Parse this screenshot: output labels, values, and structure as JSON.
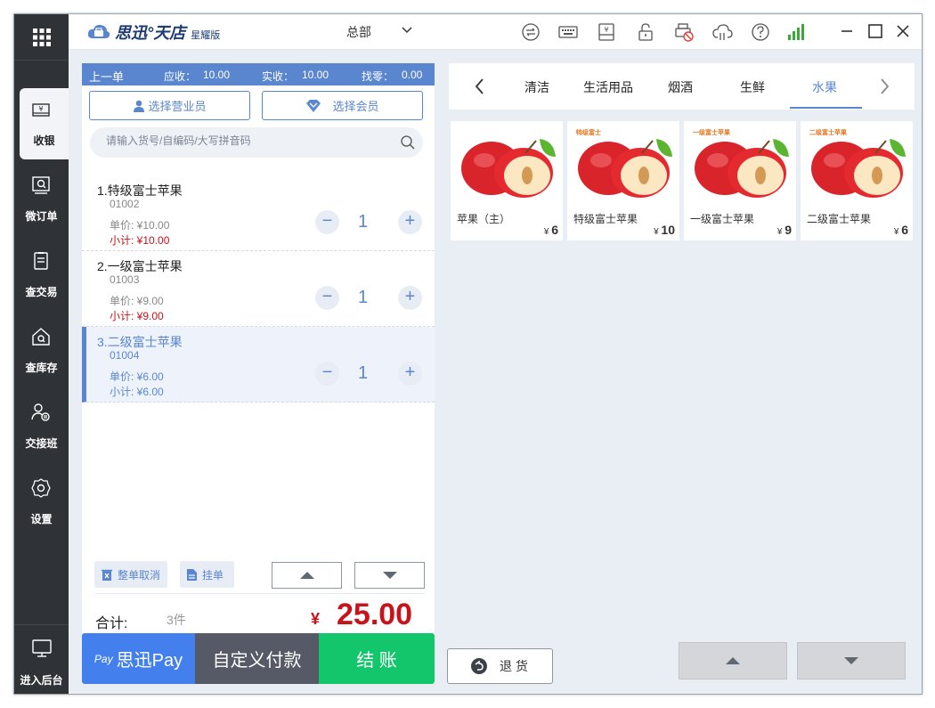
{
  "app": {
    "logo_text": "思迅°天店",
    "edition": "星耀版",
    "store": "总部"
  },
  "sidebar": {
    "items": [
      {
        "label": "收银",
        "icon": "cashier-icon"
      },
      {
        "label": "微订单",
        "icon": "micro-order-icon"
      },
      {
        "label": "查交易",
        "icon": "transaction-icon"
      },
      {
        "label": "查库存",
        "icon": "inventory-icon"
      },
      {
        "label": "交接班",
        "icon": "shift-handover-icon"
      },
      {
        "label": "设置",
        "icon": "settings-icon"
      }
    ],
    "backend_label": "进入后台"
  },
  "cart": {
    "header": {
      "prev_order": "上一单",
      "receivable_label": "应收：",
      "receivable": "10.00",
      "received_label": "实收：",
      "received": "10.00",
      "change_label": "找零：",
      "change": "0.00"
    },
    "salesperson_button": "选择营业员",
    "member_button": "选择会员",
    "search_placeholder": "请输入货号/自编码/大写拼音码",
    "items": [
      {
        "name": "1.特级富士苹果",
        "code": "01002",
        "price": "单价: ¥10.00",
        "subtotal": "小计: ¥10.00",
        "qty": "1"
      },
      {
        "name": "2.一级富士苹果",
        "code": "01003",
        "price": "单价: ¥9.00",
        "subtotal": "小计: ¥9.00",
        "qty": "1"
      },
      {
        "name": "3.二级富士苹果",
        "code": "01004",
        "price": "单价: ¥6.00",
        "subtotal": "小计: ¥6.00",
        "qty": "1"
      }
    ],
    "cancel_all": "整单取消",
    "hold": "挂单",
    "total_label": "合计:",
    "total_count": "3件",
    "currency": "¥",
    "total_amount": "25.00"
  },
  "pay": {
    "pay_badge": "Pay",
    "sixun_pay": "思迅Pay",
    "custom_pay": "自定义付款",
    "checkout": "结 账"
  },
  "categories": {
    "items": [
      "清洁",
      "生活用品",
      "烟酒",
      "生鲜",
      "水果"
    ],
    "active": "水果"
  },
  "products": [
    {
      "name": "苹果（主）",
      "price": "6",
      "tag": ""
    },
    {
      "name": "特级富士苹果",
      "price": "10",
      "tag": "特级富士"
    },
    {
      "name": "一级富士苹果",
      "price": "9",
      "tag": "一级富士苹果"
    },
    {
      "name": "二级富士苹果",
      "price": "6",
      "tag": "二级富士苹果"
    }
  ],
  "return_button": "退 货",
  "colors": {
    "accent": "#5a86cf",
    "price_red": "#c8131a",
    "checkout_green": "#13c56b",
    "sidebar_dark": "#2f3237"
  }
}
